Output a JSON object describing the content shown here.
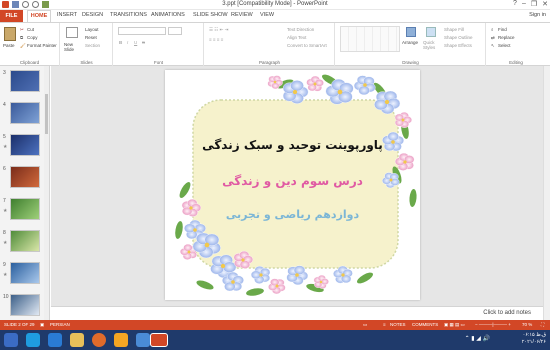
{
  "window": {
    "title": "3.ppt [Compatibility Mode] - PowerPoint",
    "help": "?",
    "minimize": "–",
    "restore": "❐",
    "close": "✕"
  },
  "tabs": {
    "file": "FILE",
    "home": "HOME",
    "items": [
      "INSERT",
      "DESIGN",
      "TRANSITIONS",
      "ANIMATIONS",
      "SLIDE SHOW",
      "REVIEW",
      "VIEW"
    ],
    "signin": "Sign in"
  },
  "ribbon": {
    "clipboard": {
      "label": "Clipboard",
      "paste": "Paste",
      "cut": "Cut",
      "copy": "Copy",
      "format_painter": "Format Painter"
    },
    "slides": {
      "label": "Slides",
      "new_slide": "New Slide",
      "layout": "Layout",
      "reset": "Reset",
      "section": "Section"
    },
    "font": {
      "label": "Font",
      "bold": "B",
      "italic": "I",
      "underline": "U",
      "strike": "S",
      "font_box": "",
      "size_box": ""
    },
    "paragraph": {
      "label": "Paragraph",
      "text_direction": "Text Direction",
      "align_text": "Align Text",
      "smartart": "Convert to SmartArt"
    },
    "drawing": {
      "label": "Drawing",
      "arrange": "Arrange",
      "quick_styles": "Quick Styles",
      "shape_fill": "Shape Fill",
      "shape_outline": "Shape Outline",
      "shape_effects": "Shape Effects"
    },
    "editing": {
      "label": "Editing",
      "find": "Find",
      "replace": "Replace",
      "select": "Select"
    }
  },
  "thumbnails": [
    {
      "num": "3",
      "star": "",
      "colors": [
        "#2b4a8c",
        "#4f6fb3"
      ]
    },
    {
      "num": "4",
      "star": "",
      "colors": [
        "#3a5a9a",
        "#7fa2d6"
      ]
    },
    {
      "num": "5",
      "star": "★",
      "colors": [
        "#1b2f6a",
        "#4d72c0"
      ]
    },
    {
      "num": "6",
      "star": "",
      "colors": [
        "#7a2c1a",
        "#d26a3c"
      ]
    },
    {
      "num": "7",
      "star": "★",
      "colors": [
        "#3f7f2f",
        "#9fd07a"
      ]
    },
    {
      "num": "8",
      "star": "★",
      "colors": [
        "#4f8c3a",
        "#d9e6a8"
      ]
    },
    {
      "num": "9",
      "star": "★",
      "colors": [
        "#2a5f9e",
        "#a9c8ec"
      ]
    },
    {
      "num": "10",
      "star": "",
      "colors": [
        "#3c5f88",
        "#e0e8f3"
      ]
    }
  ],
  "slide": {
    "line1": "پاورپوینت توحید و سبک زندگی",
    "line2": "درس سوم دین و زندگی",
    "line3": "دوازدهم ریاضی و تجربی",
    "colors": {
      "line1": "#111111",
      "line2": "#e05aa3",
      "line3": "#7bb6d6",
      "frame_bg": "#f6f2cc",
      "frame_border": "#cfd7a3"
    }
  },
  "notes": {
    "placeholder": "Click to add notes"
  },
  "status": {
    "slide": "SLIDE 2 OF 29",
    "language": "PERSIAN",
    "notes": "NOTES",
    "comments": "COMMENTS",
    "zoom": "70 %"
  },
  "taskbar": {
    "time": "۰۶:۱۵ ق.ظ",
    "date": "۲۰۲۱/۰۶/۲۶"
  }
}
